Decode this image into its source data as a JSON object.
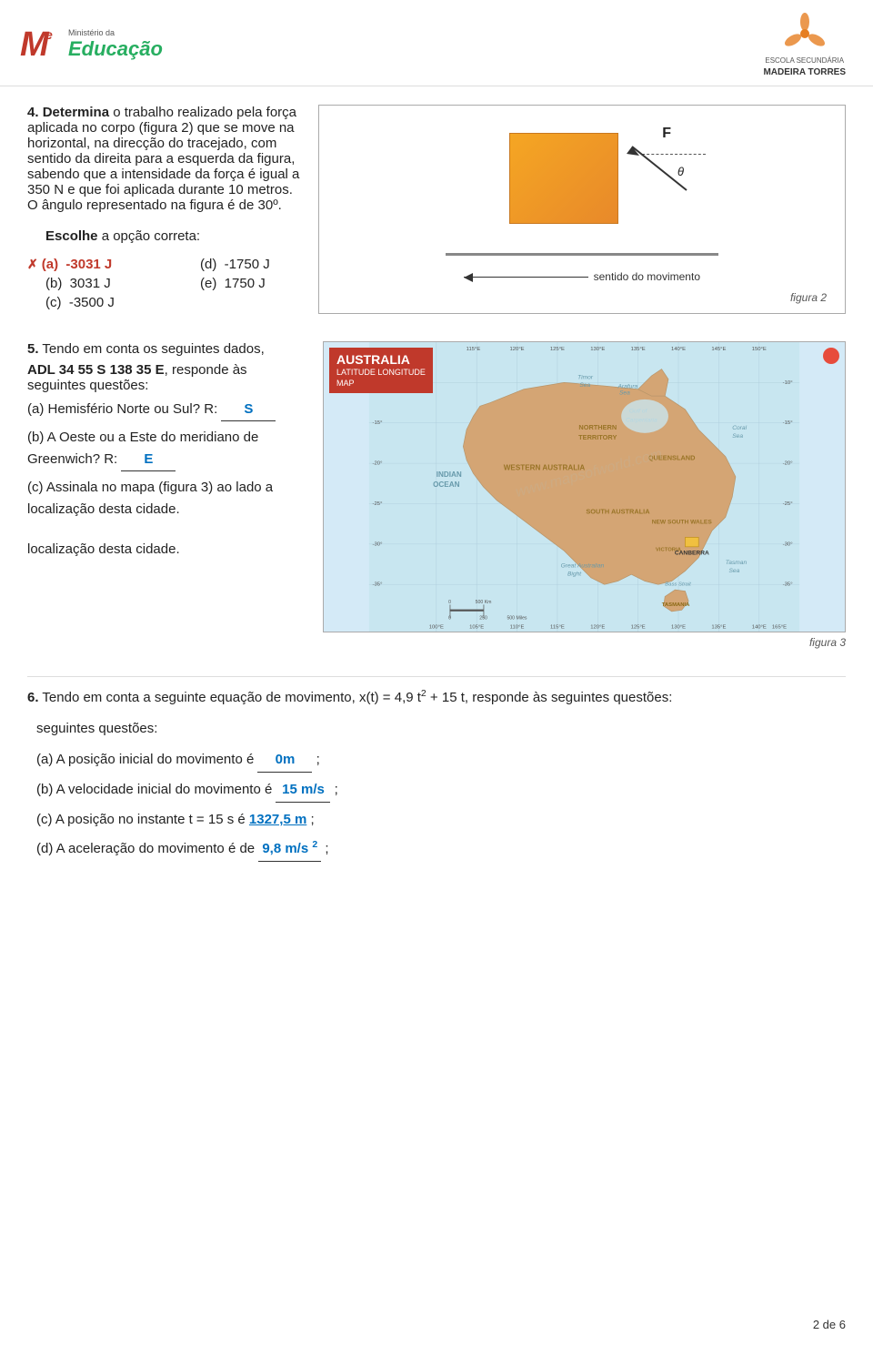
{
  "header": {
    "logo_mp": "ME",
    "ministerio": "Ministério da",
    "educacao": "Educação",
    "school_name": "MADEIRA TORRES",
    "school_subtitle": "ESCOLA SECUNDÁRIA"
  },
  "question4": {
    "number": "4.",
    "bold_word": "Determina",
    "text": " o trabalho realizado pela força aplicada no corpo (figura 2) que se move na horizontal, na direcção do tracejado, com sentido da direita para a esquerda da figura, sabendo que a intensidade da força é igual a 350 N e que foi aplicada durante 10 metros. O ângulo representado na figura é de 30º.",
    "escolhe_label": "Escolhe",
    "escolhe_text": " a opção correta:",
    "options": [
      {
        "label": "X(a)",
        "value": "-3031 J",
        "correct": true
      },
      {
        "label": "(b)",
        "value": "3031 J"
      },
      {
        "label": "(c)",
        "value": "-3500 J"
      }
    ],
    "options_right": [
      {
        "label": "(d)",
        "value": "-1750 J"
      },
      {
        "label": "(e)",
        "value": "1750 J"
      }
    ],
    "diagram_label": "sentido do movimento",
    "f_label": "F",
    "theta_label": "θ",
    "figura_label": "figura 2"
  },
  "question5": {
    "number": "5.",
    "intro": "Tendo em conta os seguintes dados,",
    "bold_data": "ADL 34 55 S 138 35 E",
    "text": ", responde às seguintes questões:",
    "sub_a_label": "(a) Hemisfério Norte ou Sul? R:",
    "sub_a_answer": "S",
    "sub_b_label": "(b) A Oeste ou a Este do meridiano de Greenwich? R:",
    "sub_b_answer": "E",
    "sub_c_label": "(c) Assinala no mapa (figura 3) ao lado a localização desta cidade.",
    "figura_label": "figura 3",
    "map_title": "AUSTRALIA",
    "map_subtitle": "LATITUDE LONGITUDE\nMAP"
  },
  "question6": {
    "number": "6.",
    "intro": "Tendo em conta a seguinte equação de movimento, x(t) = 4,9 t",
    "exp": "2",
    "intro2": " + 15 t, responde às seguintes questões:",
    "sub_a": "(a) A posição inicial do movimento é",
    "sub_a_answer": "0m",
    "sub_a_end": ";",
    "sub_b": "(b) A velocidade inicial do movimento é",
    "sub_b_answer": "15 m/s",
    "sub_b_end": ";",
    "sub_c": "(c) A posição no instante t = 15 s é",
    "sub_c_answer": "1327,5 m",
    "sub_c_end": ";",
    "sub_d": "(d) A aceleração do movimento é de",
    "sub_d_answer": "9,8 m/s",
    "sub_d_exp": "2",
    "sub_d_end": ";"
  },
  "footer": {
    "page": "2 de 6"
  }
}
